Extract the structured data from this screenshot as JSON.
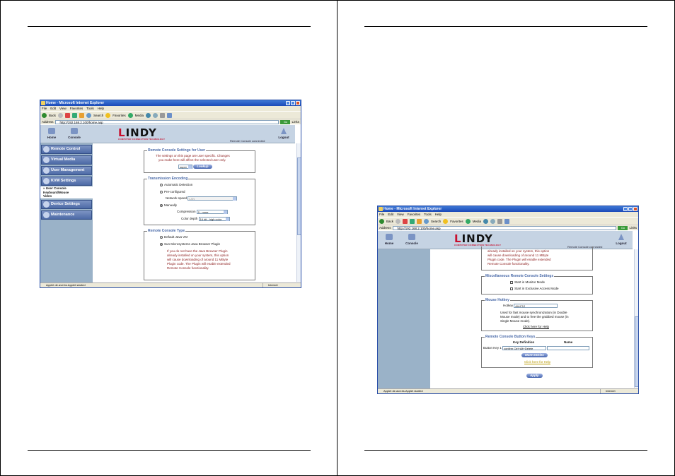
{
  "left": {
    "browser": {
      "title": "Home - Microsoft Internet Explorer",
      "menu": [
        "File",
        "Edit",
        "View",
        "Favorites",
        "Tools",
        "Help"
      ],
      "toolbar": {
        "back": "Back",
        "search": "Search",
        "favorites": "Favorites",
        "media": "Media"
      },
      "address_label": "Address",
      "address_url": "http://192.168.2.100/home.asp",
      "go": "Go",
      "links": "Links",
      "status_text": "Applet de.avd.bs.Applet started",
      "status_zone": "Internet"
    },
    "app": {
      "nav_home": "Home",
      "nav_console": "Console",
      "logo": "LINDY",
      "logo_sub": "COMPUTER CONNECTION TECHNOLOGY",
      "connected": "Remote Console connected",
      "logout": "Logout",
      "sidebar": [
        "Remote Control",
        "Virtual Media",
        "User Management",
        "KVM Settings"
      ],
      "sub_items": [
        "User Console",
        "Keyboard/Mouse",
        "Video"
      ],
      "sidebar_after": [
        "Device Settings",
        "Maintenance"
      ]
    },
    "sections": {
      "user_settings": {
        "legend": "Remote Console Settings for User",
        "text1": "The settings on this page are user specific. Changes",
        "text2": "you make here will affect the selected user only.",
        "user_value": "super",
        "lookup": "Lookup"
      },
      "transmission": {
        "legend": "Transmission Encoding",
        "auto": "Automatic Detection",
        "preconf": "Pre-configured",
        "netspeed_label": "Network speed",
        "netspeed_value": "LAN",
        "manual": "Manually",
        "compression_label": "Compression",
        "compression_value": "0 - none",
        "colordepth_label": "Color depth",
        "colordepth_value": "16 bit - high color"
      },
      "console_type": {
        "legend": "Remote Console Type",
        "default_jvm": "Default Java VM",
        "sun": "Sun Microsystems Java Browser Plugin",
        "p1": "If you do not have the Java Browser Plugin",
        "p2": "already installed on your system, this option",
        "p3": "will cause downloading of around 11 MByte",
        "p4": "Plugin code. The Plugin will enable extended",
        "p5": "Remote Console functionality."
      }
    }
  },
  "right": {
    "browser": {
      "title": "Home - Microsoft Internet Explorer",
      "menu": [
        "File",
        "Edit",
        "View",
        "Favorites",
        "Tools",
        "Help"
      ],
      "toolbar": {
        "back": "Back",
        "search": "Search",
        "favorites": "Favorites",
        "media": "Media"
      },
      "address_label": "Address",
      "address_url": "http://192.168.2.100/home.asp",
      "go": "Go",
      "links": "Links",
      "status_text": "Applet de.avd.bs.Applet started",
      "status_zone": "Internet"
    },
    "app": {
      "nav_home": "Home",
      "nav_console": "Console",
      "logo": "LINDY",
      "logo_sub": "COMPUTER CONNECTION TECHNOLOGY",
      "connected": "Remote Console connected",
      "logout": "Logout"
    },
    "sections": {
      "top_text": {
        "p1": "already installed on your system, this option",
        "p2": "will cause downloading of around 11 MByte",
        "p3": "Plugin code. The Plugin will enable extended",
        "p4": "Remote Console functionality."
      },
      "misc": {
        "legend": "Miscellaneous Remote Console Settings",
        "monitor": "Start in Monitor Mode",
        "exclusive": "Start in Exclusive Access Mode"
      },
      "hotkey": {
        "legend": "Mouse Hotkey",
        "label": "Hotkey",
        "value": "Alt+F12",
        "d1": "Used for fast mouse synchronization (in Double",
        "d2": "Mouse mode) and to free the grabbed mouse (in",
        "d3": "Single Mouse mode).",
        "help": "Click here for Help"
      },
      "buttons": {
        "legend": "Remote Console Button Keys",
        "col_key": "Key Definition",
        "col_name": "Name",
        "row_label": "Button Key 1",
        "row_value": "confirm Ctrl+Alt+Delete",
        "more": "More entries",
        "help": "Click here for Help"
      },
      "apply": "Apply"
    }
  }
}
